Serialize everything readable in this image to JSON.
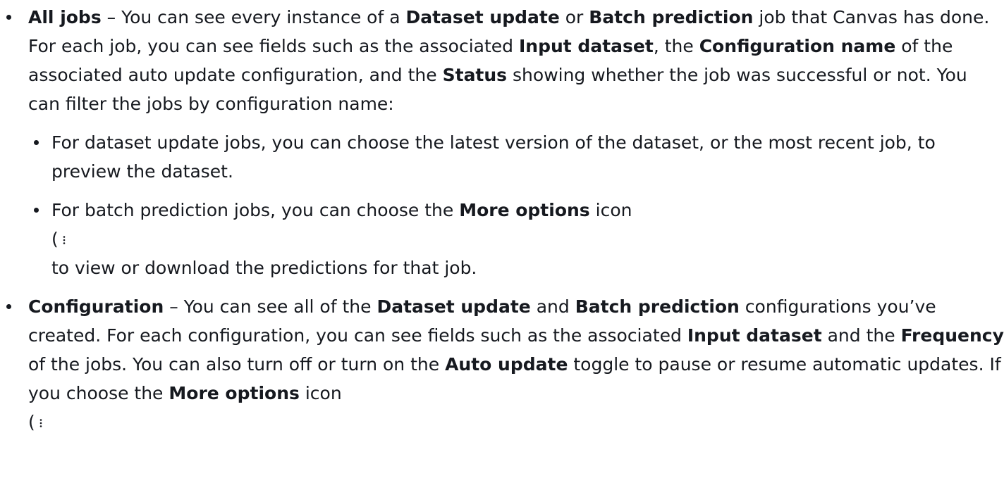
{
  "items": [
    {
      "parts": [
        {
          "t": "All jobs",
          "b": true
        },
        {
          "t": " – You can see every instance of a ",
          "b": false
        },
        {
          "t": "Dataset update",
          "b": true
        },
        {
          "t": " or ",
          "b": false
        },
        {
          "t": "Batch prediction",
          "b": true
        },
        {
          "t": " job that Canvas has done. For each job, you can see fields such as the associated ",
          "b": false
        },
        {
          "t": "Input dataset",
          "b": true
        },
        {
          "t": ", the ",
          "b": false
        },
        {
          "t": "Configuration name",
          "b": true
        },
        {
          "t": " of the associated auto update configuration, and the ",
          "b": false
        },
        {
          "t": "Status",
          "b": true
        },
        {
          "t": " showing whether the job was successful or not. You can filter the jobs by configuration name:",
          "b": false
        }
      ],
      "subitems": [
        {
          "text": "For dataset update jobs, you can choose the latest version of the dataset, or the most recent job, to preview the dataset."
        },
        {
          "before": "For batch prediction jobs, you can choose the ",
          "bold": "More options",
          "after": " icon",
          "paren": "(",
          "icon": "more-options-icon",
          "tail": "to view or download the predictions for that job."
        }
      ]
    },
    {
      "parts": [
        {
          "t": "Configuration",
          "b": true
        },
        {
          "t": " – You can see all of the ",
          "b": false
        },
        {
          "t": "Dataset update",
          "b": true
        },
        {
          "t": " and ",
          "b": false
        },
        {
          "t": "Batch prediction",
          "b": true
        },
        {
          "t": " configurations you’ve created. For each configuration, you can see fields such as the associated ",
          "b": false
        },
        {
          "t": "Input dataset",
          "b": true
        },
        {
          "t": " and the ",
          "b": false
        },
        {
          "t": "Frequency",
          "b": true
        },
        {
          "t": " of the jobs. You can also turn off or turn on the ",
          "b": false
        },
        {
          "t": "Auto update",
          "b": true
        },
        {
          "t": " toggle to pause or resume automatic updates. If you choose the ",
          "b": false
        },
        {
          "t": "More options",
          "b": true
        },
        {
          "t": " icon",
          "b": false
        }
      ],
      "paren": "(",
      "icon": "more-options-icon"
    }
  ]
}
